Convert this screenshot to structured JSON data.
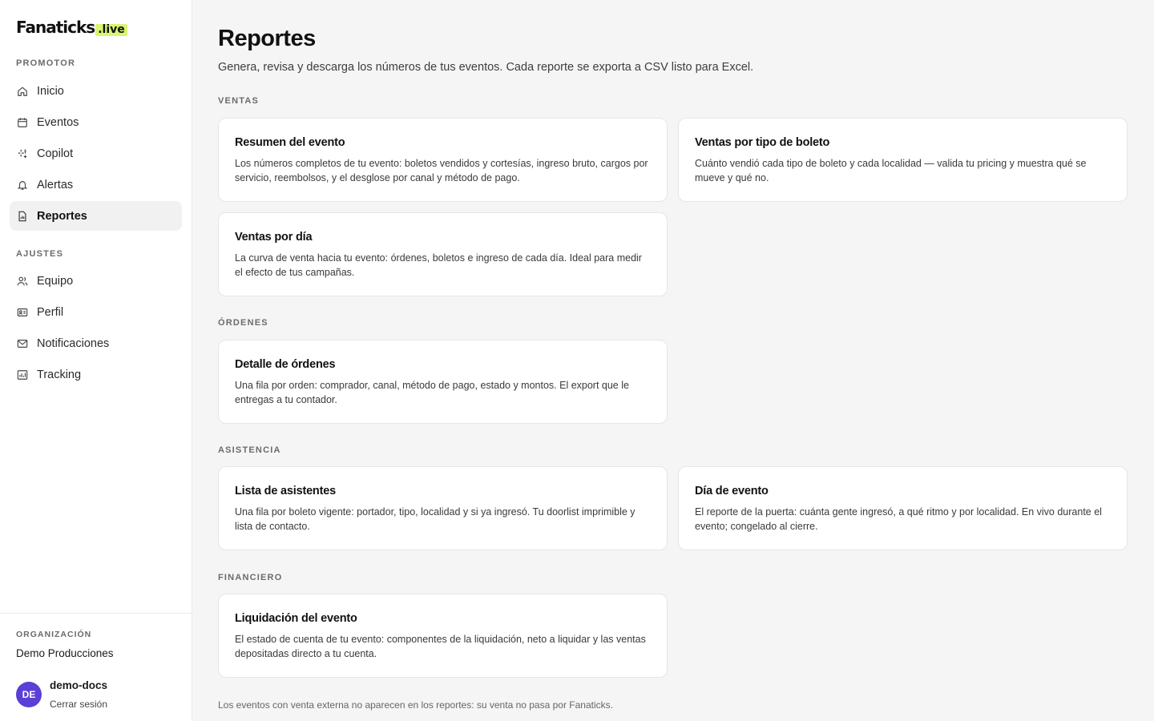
{
  "brand": {
    "name": "Fanaticks",
    "suffix": ".live"
  },
  "sidebar": {
    "sections": [
      {
        "label": "PROMOTOR",
        "items": [
          {
            "label": "Inicio",
            "icon": "home-icon"
          },
          {
            "label": "Eventos",
            "icon": "calendar-icon"
          },
          {
            "label": "Copilot",
            "icon": "sparkle-icon"
          },
          {
            "label": "Alertas",
            "icon": "bell-icon"
          },
          {
            "label": "Reportes",
            "icon": "report-icon",
            "active": true
          }
        ]
      },
      {
        "label": "AJUSTES",
        "items": [
          {
            "label": "Equipo",
            "icon": "users-icon"
          },
          {
            "label": "Perfil",
            "icon": "id-card-icon"
          },
          {
            "label": "Notificaciones",
            "icon": "mail-icon"
          },
          {
            "label": "Tracking",
            "icon": "chart-icon"
          }
        ]
      }
    ],
    "footer": {
      "org_label": "ORGANIZACIÓN",
      "org_name": "Demo Producciones",
      "avatar_initials": "DE",
      "avatar_color": "#5b3fd6",
      "user_name": "demo-docs",
      "logout_label": "Cerrar sesión"
    }
  },
  "main": {
    "title": "Reportes",
    "subtitle": "Genera, revisa y descarga los números de tus eventos. Cada reporte se exporta a CSV listo para Excel.",
    "groups": [
      {
        "label": "VENTAS",
        "cards": [
          {
            "title": "Resumen del evento",
            "description": "Los números completos de tu evento: boletos vendidos y cortesías, ingreso bruto, cargos por servicio, reembolsos, y el desglose por canal y método de pago."
          },
          {
            "title": "Ventas por tipo de boleto",
            "description": "Cuánto vendió cada tipo de boleto y cada localidad — valida tu pricing y muestra qué se mueve y qué no."
          },
          {
            "title": "Ventas por día",
            "description": "La curva de venta hacia tu evento: órdenes, boletos e ingreso de cada día. Ideal para medir el efecto de tus campañas."
          }
        ]
      },
      {
        "label": "ÓRDENES",
        "cards": [
          {
            "title": "Detalle de órdenes",
            "description": "Una fila por orden: comprador, canal, método de pago, estado y montos. El export que le entregas a tu contador."
          }
        ]
      },
      {
        "label": "ASISTENCIA",
        "cards": [
          {
            "title": "Lista de asistentes",
            "description": "Una fila por boleto vigente: portador, tipo, localidad y si ya ingresó. Tu doorlist imprimible y lista de contacto."
          },
          {
            "title": "Día de evento",
            "description": "El reporte de la puerta: cuánta gente ingresó, a qué ritmo y por localidad. En vivo durante el evento; congelado al cierre."
          }
        ]
      },
      {
        "label": "FINANCIERO",
        "cards": [
          {
            "title": "Liquidación del evento",
            "description": "El estado de cuenta de tu evento: componentes de la liquidación, neto a liquidar y las ventas depositadas directo a tu cuenta."
          }
        ]
      }
    ],
    "footnote": "Los eventos con venta externa no aparecen en los reportes: su venta no pasa por Fanaticks."
  }
}
